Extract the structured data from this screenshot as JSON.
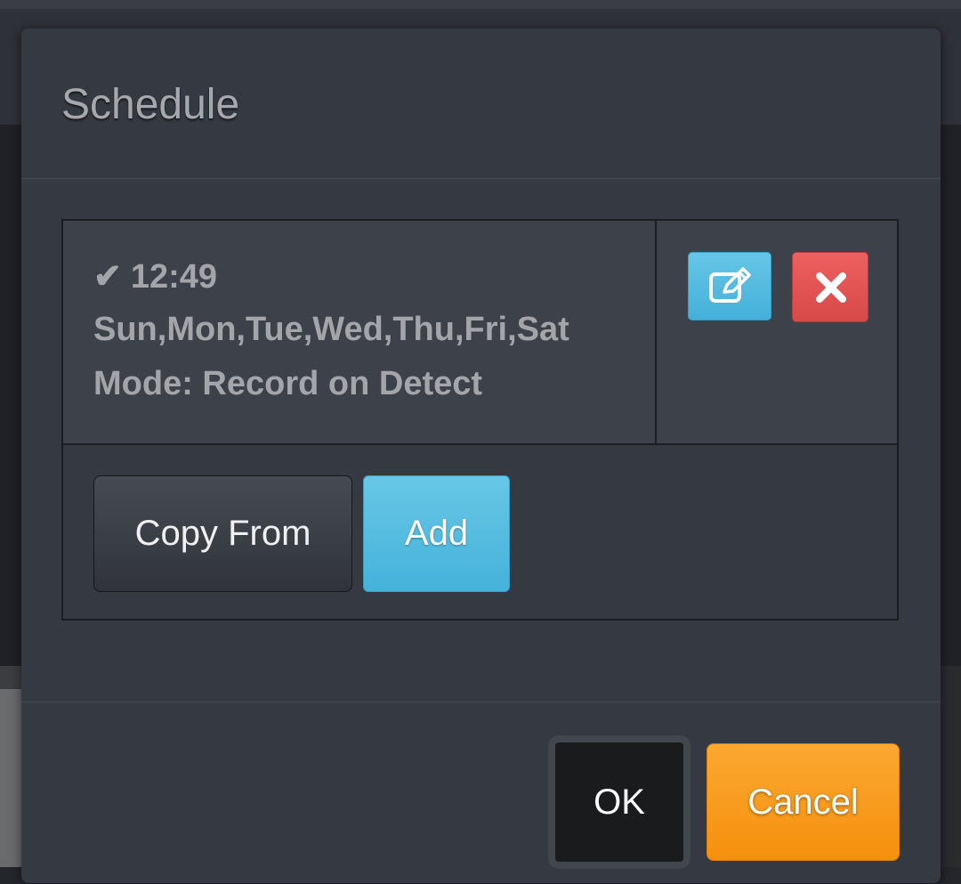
{
  "dialog": {
    "title": "Schedule"
  },
  "schedule": {
    "entries": [
      {
        "enabled_icon": "checkmark-icon",
        "time": "12:49",
        "days": "Sun,Mon,Tue,Wed,Thu,Fri,Sat",
        "mode": "Mode: Record on Detect",
        "edit_icon": "edit-icon",
        "delete_icon": "close-icon"
      }
    ],
    "copy_from_label": "Copy From",
    "add_label": "Add"
  },
  "footer": {
    "ok_label": "OK",
    "cancel_label": "Cancel"
  },
  "colors": {
    "primary_blue": "#4fb9df",
    "danger_red": "#e35454",
    "warning_orange": "#f7980f",
    "dialog_bg": "#353a42"
  }
}
